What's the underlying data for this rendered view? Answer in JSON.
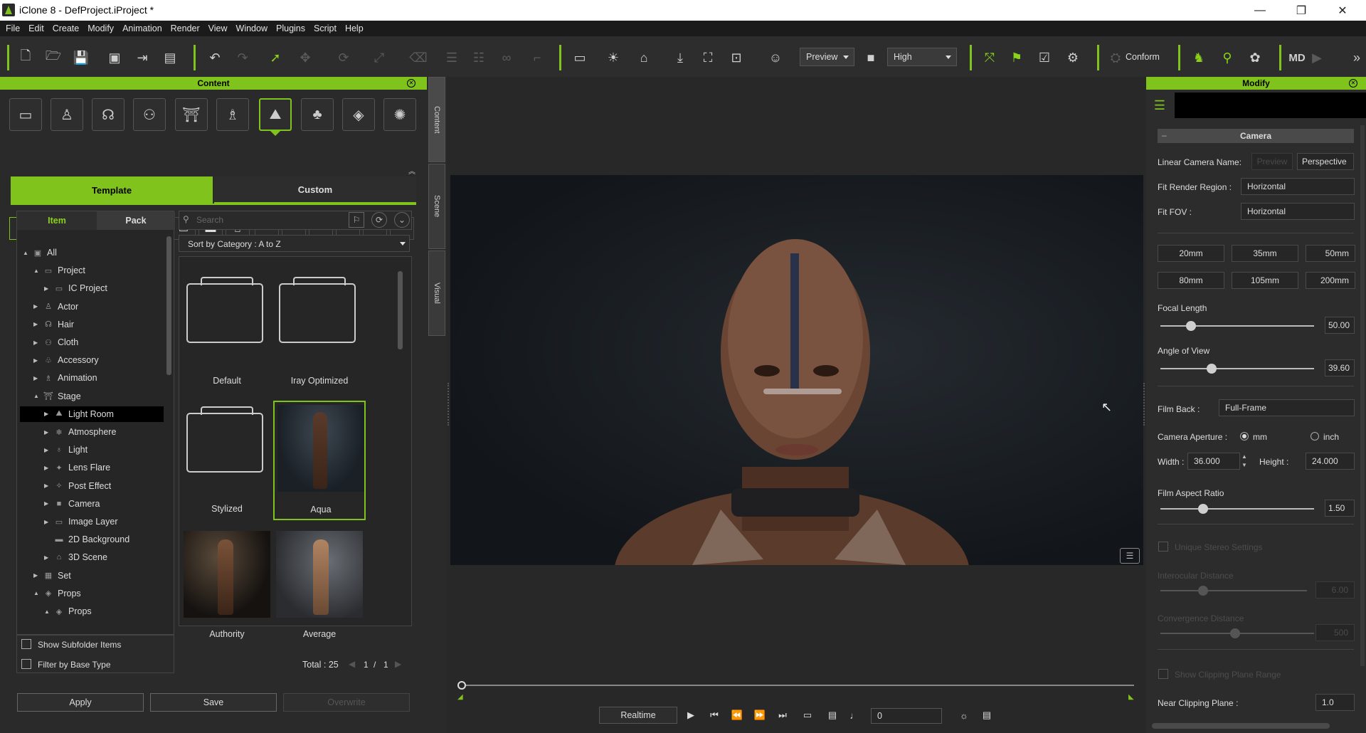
{
  "window": {
    "title": "iClone 8 - DefProject.iProject *",
    "minimize": "—",
    "restore": "❐",
    "close": "✕"
  },
  "menu": [
    "File",
    "Edit",
    "Create",
    "Modify",
    "Animation",
    "Render",
    "View",
    "Window",
    "Plugins",
    "Script",
    "Help"
  ],
  "toolbar": {
    "preview_mode": "Preview",
    "quality": "High",
    "conform": "Conform",
    "md_label": "MD"
  },
  "content": {
    "title": "Content",
    "tabs": {
      "template": "Template",
      "custom": "Custom"
    },
    "subtabs": {
      "item": "Item",
      "pack": "Pack"
    },
    "search_placeholder": "Search",
    "sort": "Sort by Category : A to Z",
    "tree": [
      {
        "label": "All",
        "level": 0,
        "arrow": "▲"
      },
      {
        "label": "Project",
        "level": 1,
        "arrow": "▲"
      },
      {
        "label": "IC Project",
        "level": 2,
        "arrow": "▶"
      },
      {
        "label": "Actor",
        "level": 1,
        "arrow": "▶"
      },
      {
        "label": "Hair",
        "level": 1,
        "arrow": "▶"
      },
      {
        "label": "Cloth",
        "level": 1,
        "arrow": "▶"
      },
      {
        "label": "Accessory",
        "level": 1,
        "arrow": "▶"
      },
      {
        "label": "Animation",
        "level": 1,
        "arrow": "▶"
      },
      {
        "label": "Stage",
        "level": 1,
        "arrow": "▲"
      },
      {
        "label": "Light Room",
        "level": 2,
        "arrow": "▶"
      },
      {
        "label": "Atmosphere",
        "level": 2,
        "arrow": "▶"
      },
      {
        "label": "Light",
        "level": 2,
        "arrow": "▶"
      },
      {
        "label": "Lens Flare",
        "level": 2,
        "arrow": "▶"
      },
      {
        "label": "Post Effect",
        "level": 2,
        "arrow": "▶"
      },
      {
        "label": "Camera",
        "level": 2,
        "arrow": "▶"
      },
      {
        "label": "Image Layer",
        "level": 2,
        "arrow": "▶"
      },
      {
        "label": "2D Background",
        "level": 2,
        "arrow": ""
      },
      {
        "label": "3D Scene",
        "level": 2,
        "arrow": "▶"
      },
      {
        "label": "Set",
        "level": 1,
        "arrow": "▶"
      },
      {
        "label": "Props",
        "level": 1,
        "arrow": "▲"
      },
      {
        "label": "Props",
        "level": 2,
        "arrow": "▲"
      }
    ],
    "thumbs": [
      {
        "label": "Default"
      },
      {
        "label": "Iray Optimized"
      },
      {
        "label": "Stylized"
      },
      {
        "label": "Aqua"
      },
      {
        "label": "Authority"
      },
      {
        "label": "Average"
      }
    ],
    "show_subfolder": "Show Subfolder Items",
    "filter_base": "Filter by Base Type",
    "total": "Total : 25",
    "page_current": "1",
    "page_sep": "/",
    "page_total": "1",
    "apply": "Apply",
    "save": "Save",
    "overwrite": "Overwrite"
  },
  "sidetabs": {
    "content": "Content",
    "scene": "Scene",
    "visual": "Visual"
  },
  "playback": {
    "realtime": "Realtime",
    "frame": "0"
  },
  "modify": {
    "title": "Modify",
    "section": "Camera",
    "linear_camera_name_label": "Linear Camera Name:",
    "preview_btn": "Preview",
    "perspective_btn": "Perspective",
    "fit_render_label": "Fit Render Region :",
    "fit_render_value": "Horizontal",
    "fit_fov_label": "Fit FOV :",
    "fit_fov_value": "Horizontal",
    "lens_row1": [
      "20mm",
      "35mm",
      "50mm"
    ],
    "lens_row2": [
      "80mm",
      "105mm",
      "200mm"
    ],
    "focal_length_label": "Focal Length",
    "focal_length_value": "50.00",
    "angle_label": "Angle of View",
    "angle_value": "39.60",
    "film_back_label": "Film Back :",
    "film_back_value": "Full-Frame",
    "aperture_label": "Camera Aperture :",
    "mm": "mm",
    "inch": "inch",
    "width_label": "Width :",
    "width_value": "36.000",
    "height_label": "Height :",
    "height_value": "24.000",
    "aspect_label": "Film Aspect Ratio",
    "aspect_value": "1.50",
    "stereo_label": "Unique Stereo Settings",
    "interocular_label": "Interocular Distance",
    "interocular_value": "6.00",
    "convergence_label": "Convergence Distance",
    "convergence_value": "500",
    "clipping_label": "Show Clipping Plane Range",
    "near_label": "Near Clipping Plane :",
    "near_value": "1.0"
  },
  "colors": {
    "accent": "#7fc31c",
    "panel": "#2a2a2a",
    "viewport": "#282828"
  }
}
